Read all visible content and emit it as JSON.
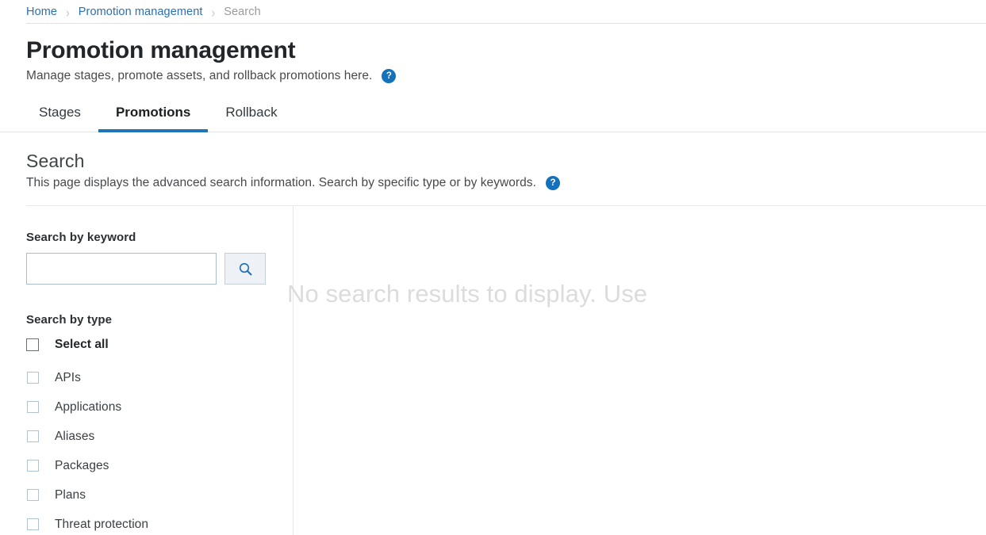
{
  "breadcrumb": {
    "items": [
      {
        "label": "Home",
        "current": false
      },
      {
        "label": "Promotion management",
        "current": false
      },
      {
        "label": "Search",
        "current": true
      }
    ],
    "separator": "›"
  },
  "header": {
    "title": "Promotion management",
    "subtitle": "Manage stages, promote assets, and rollback promotions here.",
    "help_icon": "help-circle-icon",
    "help_glyph": "?"
  },
  "tabs": [
    {
      "label": "Stages",
      "active": false
    },
    {
      "label": "Promotions",
      "active": true
    },
    {
      "label": "Rollback",
      "active": false
    }
  ],
  "section": {
    "title": "Search",
    "subtitle": "This page displays the advanced search information. Search by specific type or by keywords.",
    "help_icon": "help-circle-icon",
    "help_glyph": "?"
  },
  "search_panel": {
    "keyword_label": "Search by keyword",
    "keyword_value": "",
    "keyword_placeholder": "",
    "search_button_icon": "search-icon",
    "type_label": "Search by type",
    "select_all": {
      "label": "Select all",
      "checked": false
    },
    "types": [
      {
        "label": "APIs",
        "checked": false
      },
      {
        "label": "Applications",
        "checked": false
      },
      {
        "label": "Aliases",
        "checked": false
      },
      {
        "label": "Packages",
        "checked": false
      },
      {
        "label": "Plans",
        "checked": false
      },
      {
        "label": "Threat protection",
        "checked": false
      }
    ]
  },
  "results": {
    "empty_message": "No search results to display. Use"
  },
  "colors": {
    "accent": "#1f73b7",
    "link": "#2a6fb5",
    "help_badge": "#1571bb",
    "button_face": "#eef2f6",
    "empty_text": "#dcdcdc",
    "divider": "#e4e8eb"
  }
}
